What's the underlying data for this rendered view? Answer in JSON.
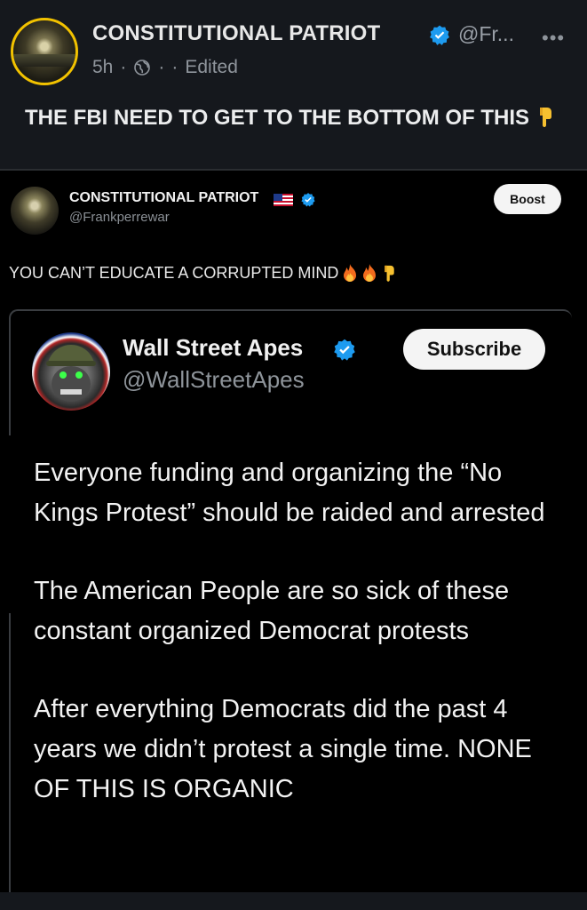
{
  "post": {
    "author_name": "CONSTITUTIONAL PATRIOT",
    "handle": "@Fr...",
    "time": "5h",
    "separator": "·",
    "edited": "Edited",
    "more": "•••",
    "text": "THE FBI NEED TO GET TO THE BOTTOM OF THIS",
    "text_emoji": "👇"
  },
  "embed": {
    "author_name": "CONSTITUTIONAL PATRIOT",
    "handle": "@Frankperrewar",
    "boost_label": "Boost",
    "caption": "YOU CAN’T EDUCATE A CORRUPTED MIND",
    "caption_emojis": [
      "🔥",
      "🔥",
      "👇"
    ]
  },
  "quote": {
    "name": "Wall Street Apes",
    "handle": "@WallStreetApes",
    "subscribe_label": "Subscribe",
    "paragraphs": [
      "Everyone funding and organizing the “No Kings Protest” should be raided and arrested",
      "The American People are so sick of these constant organized Democrat protests",
      "After everything Democrats did the past 4 years we didn’t protest a single time. NONE OF THIS IS ORGANIC"
    ]
  },
  "colors": {
    "verified": "#1d9bf0",
    "avatar_ring": "#f2c200",
    "background": "#15181d"
  }
}
